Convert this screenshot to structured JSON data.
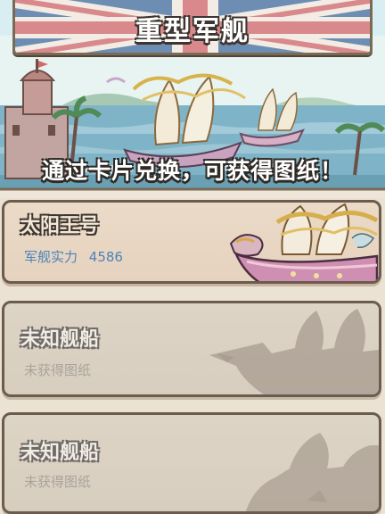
{
  "header": {
    "title": "重型军舰",
    "caption": "通过卡片兑换，可获得图纸！"
  },
  "ships": [
    {
      "name": "未知舰船",
      "status": "未获得图纸",
      "locked": true,
      "art_icon": "ship-silhouette-icon"
    }
  ],
  "featured_ship": {
    "name": "太阳王号",
    "power_label": "军舰实力",
    "power_value": "4586",
    "art_icon": "ship-figurehead-icon"
  },
  "locked_ships": [
    {
      "name": "未知舰船",
      "status": "未获得图纸"
    },
    {
      "name": "未知舰船",
      "status": "未获得图纸"
    }
  ],
  "colors": {
    "flag_blue": "#6d8db2",
    "flag_red": "#d9898b",
    "power_text": "#4c83b8",
    "card_border": "#6b5c4d"
  }
}
